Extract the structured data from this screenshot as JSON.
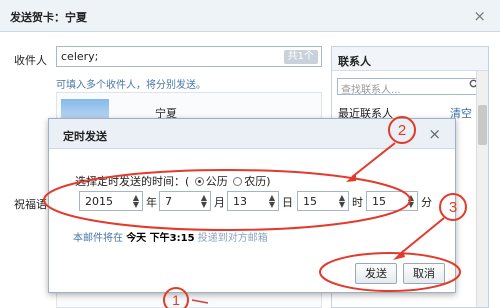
{
  "window": {
    "title": "发送贺卡：宁夏",
    "close_glyph": "×"
  },
  "compose": {
    "recipient_label": "收件人",
    "recipient_value": "celery;",
    "recipient_count": "共1个",
    "recipient_hint": "可填入多个收件人，将分别发送。",
    "card_title": "宁夏",
    "blessing_label": "祝福语"
  },
  "contacts": {
    "title": "联系人",
    "search_placeholder": "查找联系人...",
    "recent_label": "最近联系人",
    "clear_label": "清空"
  },
  "modal": {
    "title": "定时发送",
    "close_glyph": "×",
    "choose_label": "选择定时发送的时间：(",
    "calendar_solar": "公历",
    "calendar_lunar": "农历)",
    "year": "2015",
    "year_unit": "年",
    "month": "7",
    "month_unit": "月",
    "day": "13",
    "day_unit": "日",
    "hour": "15",
    "hour_unit": "时",
    "minute": "15",
    "minute_unit": "分",
    "note_prefix": "本邮件将在",
    "note_time": "今天 下午3:15",
    "note_suffix": "投递到对方邮箱",
    "send_label": "发送",
    "cancel_label": "取消"
  },
  "annotations": {
    "n1": "1",
    "n2": "2",
    "n3": "3"
  },
  "colors": {
    "annotation": "#e23b2b",
    "link": "#3a6ea5"
  }
}
